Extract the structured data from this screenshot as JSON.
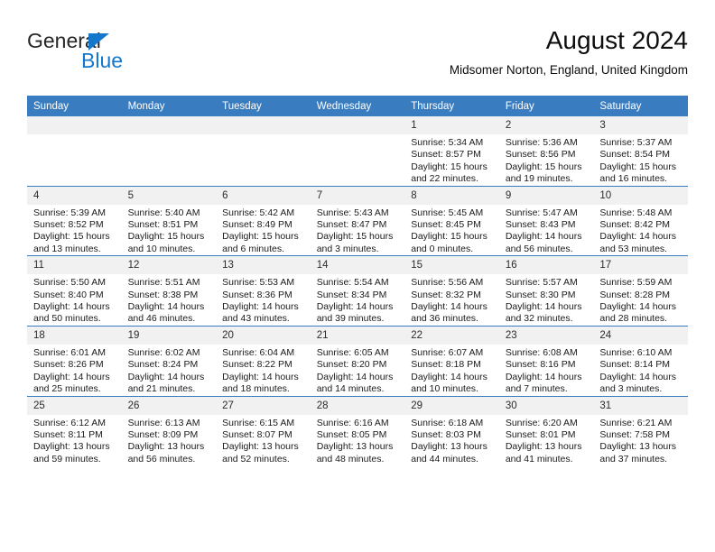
{
  "brand": {
    "name_line1": "General",
    "name_line2": "Blue",
    "accent_color": "#1377cc"
  },
  "header": {
    "title": "August 2024",
    "location": "Midsomer Norton, England, United Kingdom"
  },
  "calendar": {
    "header_bg": "#3a7cc0",
    "daynum_bg": "#f1f1f1",
    "weekdays": [
      "Sunday",
      "Monday",
      "Tuesday",
      "Wednesday",
      "Thursday",
      "Friday",
      "Saturday"
    ],
    "weeks": [
      [
        {
          "day": "",
          "blank": true
        },
        {
          "day": "",
          "blank": true
        },
        {
          "day": "",
          "blank": true
        },
        {
          "day": "",
          "blank": true
        },
        {
          "day": "1",
          "sunrise": "Sunrise: 5:34 AM",
          "sunset": "Sunset: 8:57 PM",
          "daylight": "Daylight: 15 hours and 22 minutes."
        },
        {
          "day": "2",
          "sunrise": "Sunrise: 5:36 AM",
          "sunset": "Sunset: 8:56 PM",
          "daylight": "Daylight: 15 hours and 19 minutes."
        },
        {
          "day": "3",
          "sunrise": "Sunrise: 5:37 AM",
          "sunset": "Sunset: 8:54 PM",
          "daylight": "Daylight: 15 hours and 16 minutes."
        }
      ],
      [
        {
          "day": "4",
          "sunrise": "Sunrise: 5:39 AM",
          "sunset": "Sunset: 8:52 PM",
          "daylight": "Daylight: 15 hours and 13 minutes."
        },
        {
          "day": "5",
          "sunrise": "Sunrise: 5:40 AM",
          "sunset": "Sunset: 8:51 PM",
          "daylight": "Daylight: 15 hours and 10 minutes."
        },
        {
          "day": "6",
          "sunrise": "Sunrise: 5:42 AM",
          "sunset": "Sunset: 8:49 PM",
          "daylight": "Daylight: 15 hours and 6 minutes."
        },
        {
          "day": "7",
          "sunrise": "Sunrise: 5:43 AM",
          "sunset": "Sunset: 8:47 PM",
          "daylight": "Daylight: 15 hours and 3 minutes."
        },
        {
          "day": "8",
          "sunrise": "Sunrise: 5:45 AM",
          "sunset": "Sunset: 8:45 PM",
          "daylight": "Daylight: 15 hours and 0 minutes."
        },
        {
          "day": "9",
          "sunrise": "Sunrise: 5:47 AM",
          "sunset": "Sunset: 8:43 PM",
          "daylight": "Daylight: 14 hours and 56 minutes."
        },
        {
          "day": "10",
          "sunrise": "Sunrise: 5:48 AM",
          "sunset": "Sunset: 8:42 PM",
          "daylight": "Daylight: 14 hours and 53 minutes."
        }
      ],
      [
        {
          "day": "11",
          "sunrise": "Sunrise: 5:50 AM",
          "sunset": "Sunset: 8:40 PM",
          "daylight": "Daylight: 14 hours and 50 minutes."
        },
        {
          "day": "12",
          "sunrise": "Sunrise: 5:51 AM",
          "sunset": "Sunset: 8:38 PM",
          "daylight": "Daylight: 14 hours and 46 minutes."
        },
        {
          "day": "13",
          "sunrise": "Sunrise: 5:53 AM",
          "sunset": "Sunset: 8:36 PM",
          "daylight": "Daylight: 14 hours and 43 minutes."
        },
        {
          "day": "14",
          "sunrise": "Sunrise: 5:54 AM",
          "sunset": "Sunset: 8:34 PM",
          "daylight": "Daylight: 14 hours and 39 minutes."
        },
        {
          "day": "15",
          "sunrise": "Sunrise: 5:56 AM",
          "sunset": "Sunset: 8:32 PM",
          "daylight": "Daylight: 14 hours and 36 minutes."
        },
        {
          "day": "16",
          "sunrise": "Sunrise: 5:57 AM",
          "sunset": "Sunset: 8:30 PM",
          "daylight": "Daylight: 14 hours and 32 minutes."
        },
        {
          "day": "17",
          "sunrise": "Sunrise: 5:59 AM",
          "sunset": "Sunset: 8:28 PM",
          "daylight": "Daylight: 14 hours and 28 minutes."
        }
      ],
      [
        {
          "day": "18",
          "sunrise": "Sunrise: 6:01 AM",
          "sunset": "Sunset: 8:26 PM",
          "daylight": "Daylight: 14 hours and 25 minutes."
        },
        {
          "day": "19",
          "sunrise": "Sunrise: 6:02 AM",
          "sunset": "Sunset: 8:24 PM",
          "daylight": "Daylight: 14 hours and 21 minutes."
        },
        {
          "day": "20",
          "sunrise": "Sunrise: 6:04 AM",
          "sunset": "Sunset: 8:22 PM",
          "daylight": "Daylight: 14 hours and 18 minutes."
        },
        {
          "day": "21",
          "sunrise": "Sunrise: 6:05 AM",
          "sunset": "Sunset: 8:20 PM",
          "daylight": "Daylight: 14 hours and 14 minutes."
        },
        {
          "day": "22",
          "sunrise": "Sunrise: 6:07 AM",
          "sunset": "Sunset: 8:18 PM",
          "daylight": "Daylight: 14 hours and 10 minutes."
        },
        {
          "day": "23",
          "sunrise": "Sunrise: 6:08 AM",
          "sunset": "Sunset: 8:16 PM",
          "daylight": "Daylight: 14 hours and 7 minutes."
        },
        {
          "day": "24",
          "sunrise": "Sunrise: 6:10 AM",
          "sunset": "Sunset: 8:14 PM",
          "daylight": "Daylight: 14 hours and 3 minutes."
        }
      ],
      [
        {
          "day": "25",
          "sunrise": "Sunrise: 6:12 AM",
          "sunset": "Sunset: 8:11 PM",
          "daylight": "Daylight: 13 hours and 59 minutes."
        },
        {
          "day": "26",
          "sunrise": "Sunrise: 6:13 AM",
          "sunset": "Sunset: 8:09 PM",
          "daylight": "Daylight: 13 hours and 56 minutes."
        },
        {
          "day": "27",
          "sunrise": "Sunrise: 6:15 AM",
          "sunset": "Sunset: 8:07 PM",
          "daylight": "Daylight: 13 hours and 52 minutes."
        },
        {
          "day": "28",
          "sunrise": "Sunrise: 6:16 AM",
          "sunset": "Sunset: 8:05 PM",
          "daylight": "Daylight: 13 hours and 48 minutes."
        },
        {
          "day": "29",
          "sunrise": "Sunrise: 6:18 AM",
          "sunset": "Sunset: 8:03 PM",
          "daylight": "Daylight: 13 hours and 44 minutes."
        },
        {
          "day": "30",
          "sunrise": "Sunrise: 6:20 AM",
          "sunset": "Sunset: 8:01 PM",
          "daylight": "Daylight: 13 hours and 41 minutes."
        },
        {
          "day": "31",
          "sunrise": "Sunrise: 6:21 AM",
          "sunset": "Sunset: 7:58 PM",
          "daylight": "Daylight: 13 hours and 37 minutes."
        }
      ]
    ]
  }
}
